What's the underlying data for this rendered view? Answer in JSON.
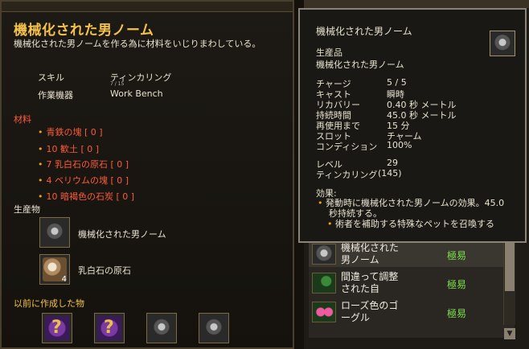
{
  "recipe": {
    "title": "機械化された男ノーム",
    "description": "機械化された男ノームを作る為に材料をいじりまわしている。",
    "skill_label": "スキル",
    "skill_value": "ティンカリング",
    "skill_sub": "7 / 15",
    "device_label": "作業機器",
    "device_value": "Work Bench",
    "materials_header": "材料",
    "materials": [
      "青鉄の塊 [ 0 ]",
      "10 歓土 [ 0 ]",
      "7 乳白石の原石 [ 0 ]",
      "4 ベリウムの塊 [ 0 ]",
      "10 暗褐色の石炭 [ 0 ]"
    ],
    "products_header": "生産物",
    "products": [
      {
        "name": "機械化された男ノーム",
        "icon": "gnome-icon"
      },
      {
        "name": "乳白石の原石",
        "icon": "opal-icon",
        "qty": "4"
      }
    ],
    "previous_header": "以前に作成した物"
  },
  "tooltip": {
    "title": "機械化された男ノーム",
    "category": "生産品",
    "subtitle": "機械化された男ノーム",
    "stats": [
      {
        "label": "チャージ",
        "value": "5 / 5"
      },
      {
        "label": "キャスト",
        "value": "瞬時"
      },
      {
        "label": "リカバリー",
        "value": "0.40 秒 メートル"
      },
      {
        "label": "持続時間",
        "value": "45.0 秒 メートル"
      },
      {
        "label": "再使用まで",
        "value": "15 分"
      },
      {
        "label": "スロット",
        "value": "チャーム"
      },
      {
        "label": "コンディション",
        "value": "100%"
      }
    ],
    "level_label": "レベル",
    "level_value": "29",
    "skill_label": "ティンカリング",
    "skill_value": "(145)",
    "effect_header": "効果:",
    "effect_line1": "発動時に機械化された男ノームの効果。45.0",
    "effect_line2": "秒持続する。",
    "effect_line3": "術者を補助する特殊なペットを召喚する"
  },
  "list": [
    {
      "name": "機械化された男ノーム",
      "difficulty": "極易"
    },
    {
      "name": "間違って調整された自",
      "difficulty": "極易"
    },
    {
      "name": "ローズ色のゴーグル",
      "difficulty": "極易"
    }
  ],
  "colors": {
    "title": "#f4c24a",
    "material": "#ff5a3a",
    "easy": "#7ce04a"
  }
}
